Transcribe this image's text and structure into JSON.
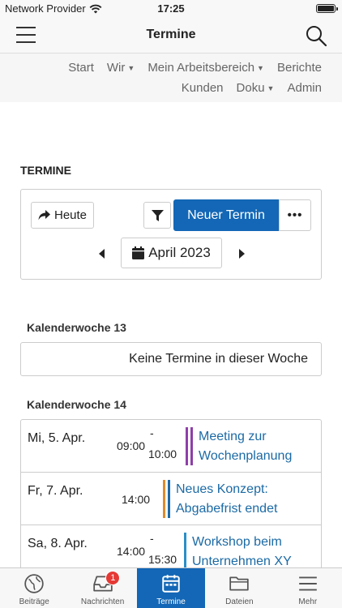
{
  "status_bar": {
    "carrier": "Network Provider",
    "time": "17:25"
  },
  "nav": {
    "title": "Termine"
  },
  "top_menu": {
    "row1": [
      {
        "label": "Start",
        "dropdown": false
      },
      {
        "label": "Wir",
        "dropdown": true
      },
      {
        "label": "Mein Arbeitsbereich",
        "dropdown": true
      },
      {
        "label": "Berichte",
        "dropdown": false
      }
    ],
    "row2": [
      {
        "label": "Kunden",
        "dropdown": false
      },
      {
        "label": "Doku",
        "dropdown": true
      },
      {
        "label": "Admin",
        "dropdown": false
      }
    ]
  },
  "section": {
    "title": "TERMINE"
  },
  "toolbar": {
    "today_label": "Heute",
    "new_label": "Neuer Termin",
    "more_label": "•••",
    "month_label": "April 2023"
  },
  "weeks": [
    {
      "label": "Kalenderwoche 13",
      "empty_text": "Keine Termine in dieser Woche"
    },
    {
      "label": "Kalenderwoche 14"
    }
  ],
  "events": [
    {
      "date": "Mi, 5. Apr.",
      "start": "09:00",
      "end": "10:00",
      "title": "Meeting zur Wochenplanung",
      "colors": [
        "#8e3fa8",
        "#8e3fa8"
      ]
    },
    {
      "date": "Fr, 7. Apr.",
      "start": "14:00",
      "end": "",
      "title": "Neues Konzept: Abgabefrist endet",
      "colors": [
        "#e08a2c",
        "#1b6aa5"
      ]
    },
    {
      "date": "Sa, 8. Apr.",
      "start": "14:00",
      "end": "15:30",
      "title": "Workshop beim Unternehmen XY",
      "colors": [
        "#2a8fc7"
      ]
    }
  ],
  "tab_bar": {
    "tabs": [
      {
        "label": "Beiträge",
        "icon": "globe-icon",
        "active": false
      },
      {
        "label": "Nachrichten",
        "icon": "inbox-icon",
        "active": false,
        "badge": "1"
      },
      {
        "label": "Termine",
        "icon": "calendar-icon",
        "active": true
      },
      {
        "label": "Dateien",
        "icon": "folder-icon",
        "active": false
      },
      {
        "label": "Mehr",
        "icon": "menu-icon",
        "active": false
      }
    ]
  },
  "colors": {
    "accent": "#1367b6",
    "link": "#1b6aa5",
    "badge": "#e53935"
  }
}
